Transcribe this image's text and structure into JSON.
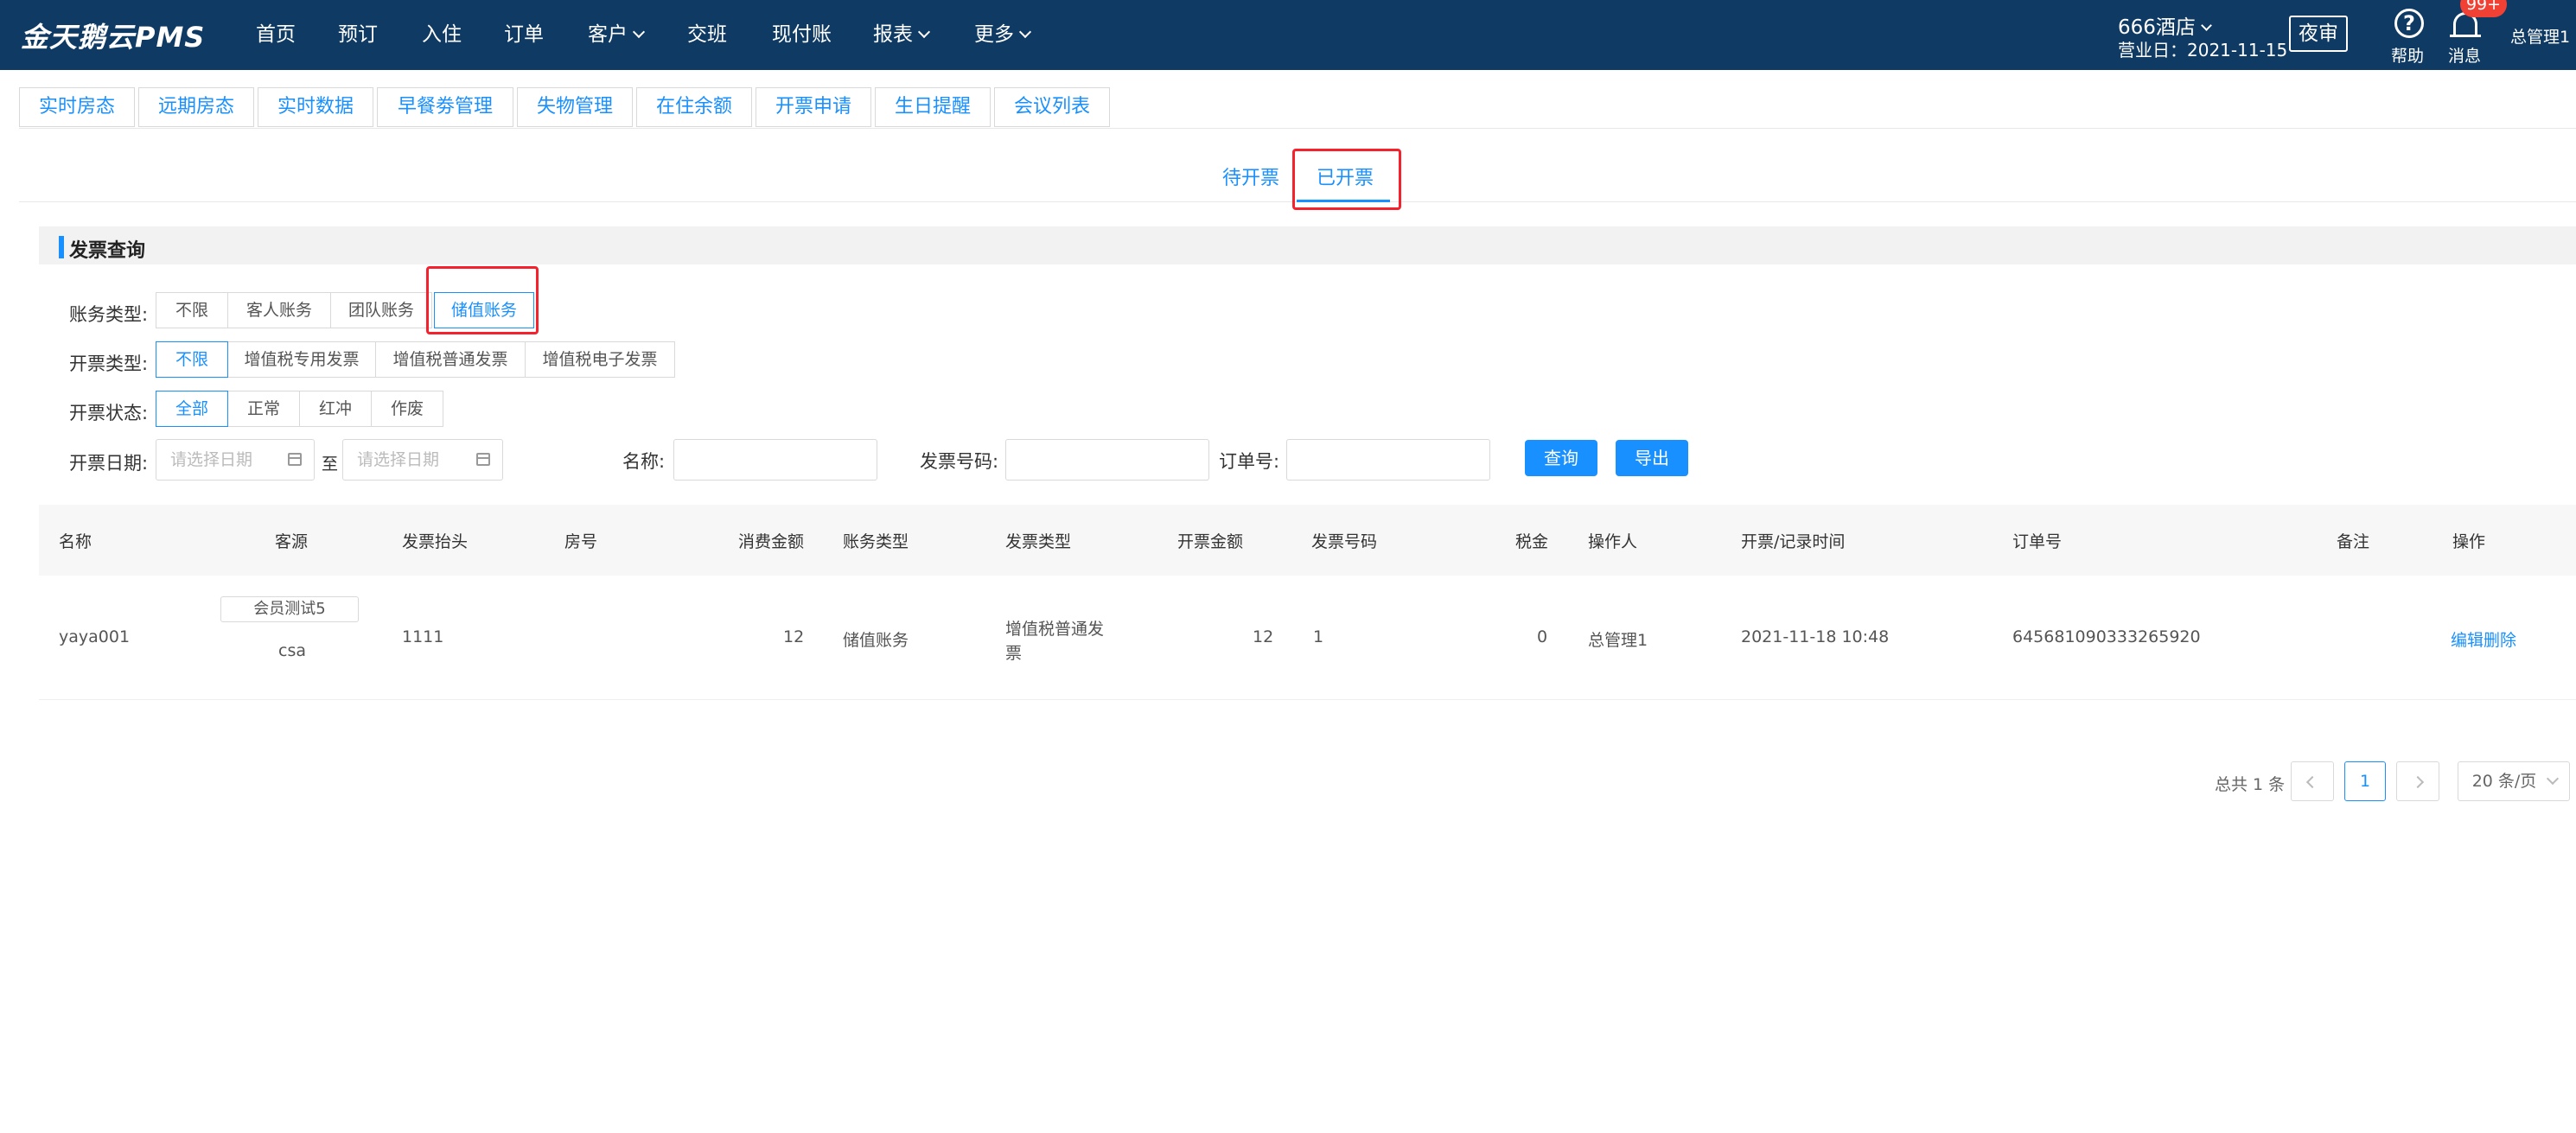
{
  "app": {
    "logo": "金天鹅云PMS",
    "nav": [
      {
        "label": "首页",
        "dropdown": false
      },
      {
        "label": "预订",
        "dropdown": false
      },
      {
        "label": "入住",
        "dropdown": false
      },
      {
        "label": "订单",
        "dropdown": false
      },
      {
        "label": "客户",
        "dropdown": true
      },
      {
        "label": "交班",
        "dropdown": false
      },
      {
        "label": "现付账",
        "dropdown": false
      },
      {
        "label": "报表",
        "dropdown": true
      },
      {
        "label": "更多",
        "dropdown": true
      }
    ],
    "hotel": "666酒店",
    "business_date": "营业日：2021-11-15",
    "night_audit": "夜审",
    "help": "帮助",
    "messages": "消息",
    "badge": "99+",
    "user": "总管理1"
  },
  "quick_tabs": [
    "实时房态",
    "远期房态",
    "实时数据",
    "早餐劵管理",
    "失物管理",
    "在住余额",
    "开票申请",
    "生日提醒",
    "会议列表"
  ],
  "sub_tabs": {
    "pending": "待开票",
    "issued": "已开票",
    "active": "issued"
  },
  "section_title": "发票查询",
  "filters": {
    "account_type": {
      "label": "账务类型:",
      "options": [
        "不限",
        "客人账务",
        "团队账务",
        "储值账务"
      ],
      "selected": 3
    },
    "invoice_type": {
      "label": "开票类型:",
      "options": [
        "不限",
        "增值税专用发票",
        "增值税普通发票",
        "增值税电子发票"
      ],
      "selected": 0
    },
    "invoice_status": {
      "label": "开票状态:",
      "options": [
        "全部",
        "正常",
        "红冲",
        "作废"
      ],
      "selected": 0
    },
    "date": {
      "label": "开票日期:",
      "start_placeholder": "请选择日期",
      "to": "至",
      "end_placeholder": "请选择日期"
    },
    "name": {
      "label": "名称:",
      "value": ""
    },
    "invoice_no": {
      "label": "发票号码:",
      "value": ""
    },
    "order_no": {
      "label": "订单号:",
      "value": ""
    },
    "query_button": "查询",
    "export_button": "导出"
  },
  "table": {
    "headers": [
      "名称",
      "客源",
      "发票抬头",
      "房号",
      "消费金额",
      "账务类型",
      "发票类型",
      "开票金额",
      "发票号码",
      "税金",
      "操作人",
      "开票/记录时间",
      "订单号",
      "备注",
      "操作"
    ],
    "rows": [
      {
        "name": "yaya001",
        "source_tag": "会员测试5",
        "source": "csa",
        "invoice_title": "1111",
        "room": "",
        "consume_amount": "12",
        "account_type": "储值账务",
        "invoice_type_line1": "增值税普通发",
        "invoice_type_line2": "票",
        "invoice_amount": "12",
        "invoice_no": "1",
        "tax": "0",
        "operator": "总管理1",
        "time": "2021-11-18 10:48",
        "order_no": "645681090333265920",
        "remark": "",
        "action_edit": "编辑",
        "action_delete": "删除"
      }
    ]
  },
  "pagination": {
    "total": "总共 1 条",
    "current": "1",
    "page_size": "20 条/页"
  }
}
